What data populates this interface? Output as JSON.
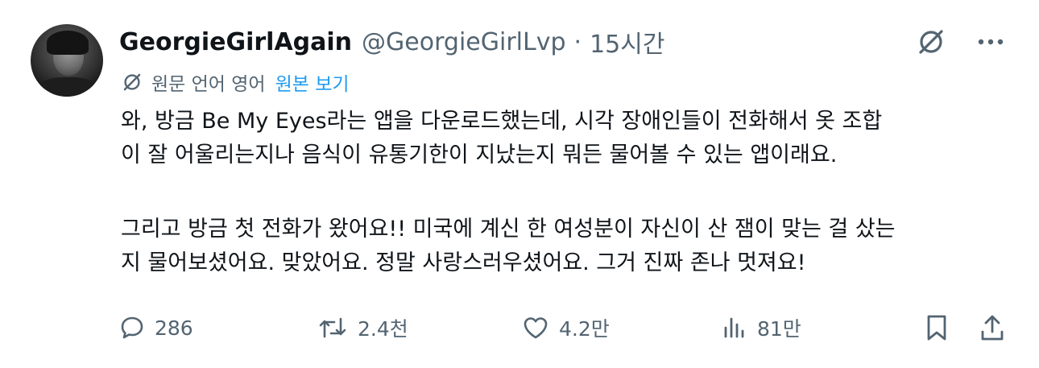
{
  "author": {
    "display_name": "GeorgieGirlAgain",
    "handle": "@GeorgieGirlLvp",
    "separator": "·",
    "time": "15시간"
  },
  "translation": {
    "label": "원문 언어 영어",
    "link": "원본 보기"
  },
  "body": {
    "lines": [
      "와, 방금 Be My Eyes라는 앱을 다운로드했는데, 시각 장애인들이 전화해서 옷 조합",
      "이 잘 어울리는지나 음식이 유통기한이 지났는지 뭐든 물어볼 수 있는 앱이래요.",
      "그리고 방금 첫 전화가 왔어요!! 미국에 계신 한 여성분이 자신이 산 잼이 맞는 걸 샀는",
      "지 물어보셨어요. 맞았어요. 정말 사랑스러우셨어요. 그거 진짜 존나 멋져요!"
    ]
  },
  "stats": {
    "replies": "286",
    "reposts": "2.4천",
    "likes": "4.2만",
    "views": "81만"
  },
  "icons": {
    "grok": "grok-icon",
    "more": "more-icon",
    "translate": "translate-icon",
    "reply": "reply-icon",
    "repost": "repost-icon",
    "like": "like-icon",
    "views": "views-icon",
    "bookmark": "bookmark-icon",
    "share": "share-icon"
  },
  "colors": {
    "text": "#0f1419",
    "secondary": "#536471",
    "link": "#1d9bf0",
    "background": "#ffffff"
  }
}
